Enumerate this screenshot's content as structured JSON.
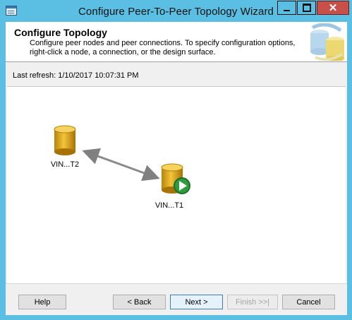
{
  "window": {
    "title": "Configure Peer-To-Peer Topology Wizard",
    "close_glyph": "✕"
  },
  "header": {
    "title": "Configure Topology",
    "description": "Configure peer nodes and peer connections. To specify configuration options, right-click a node, a connection, or the design surface."
  },
  "refresh": {
    "text": "Last refresh: 1/10/2017 10:07:31 PM"
  },
  "topology": {
    "nodes": [
      {
        "label": "VIN...T2",
        "icon": "database-icon"
      },
      {
        "label": "VIN...T1",
        "icon": "database-icon",
        "badge": "play-icon"
      }
    ],
    "connection": {
      "from": "VIN...T2",
      "to": "VIN...T1",
      "direction": "bidirectional"
    }
  },
  "buttons": {
    "help": "Help",
    "back": "< Back",
    "next": "Next >",
    "finish": "Finish >>|",
    "cancel": "Cancel"
  },
  "colors": {
    "title_bar": "#5bbfe3",
    "close_button": "#c7504a",
    "database": "#e0a818",
    "play_badge": "#2e8b3a"
  }
}
